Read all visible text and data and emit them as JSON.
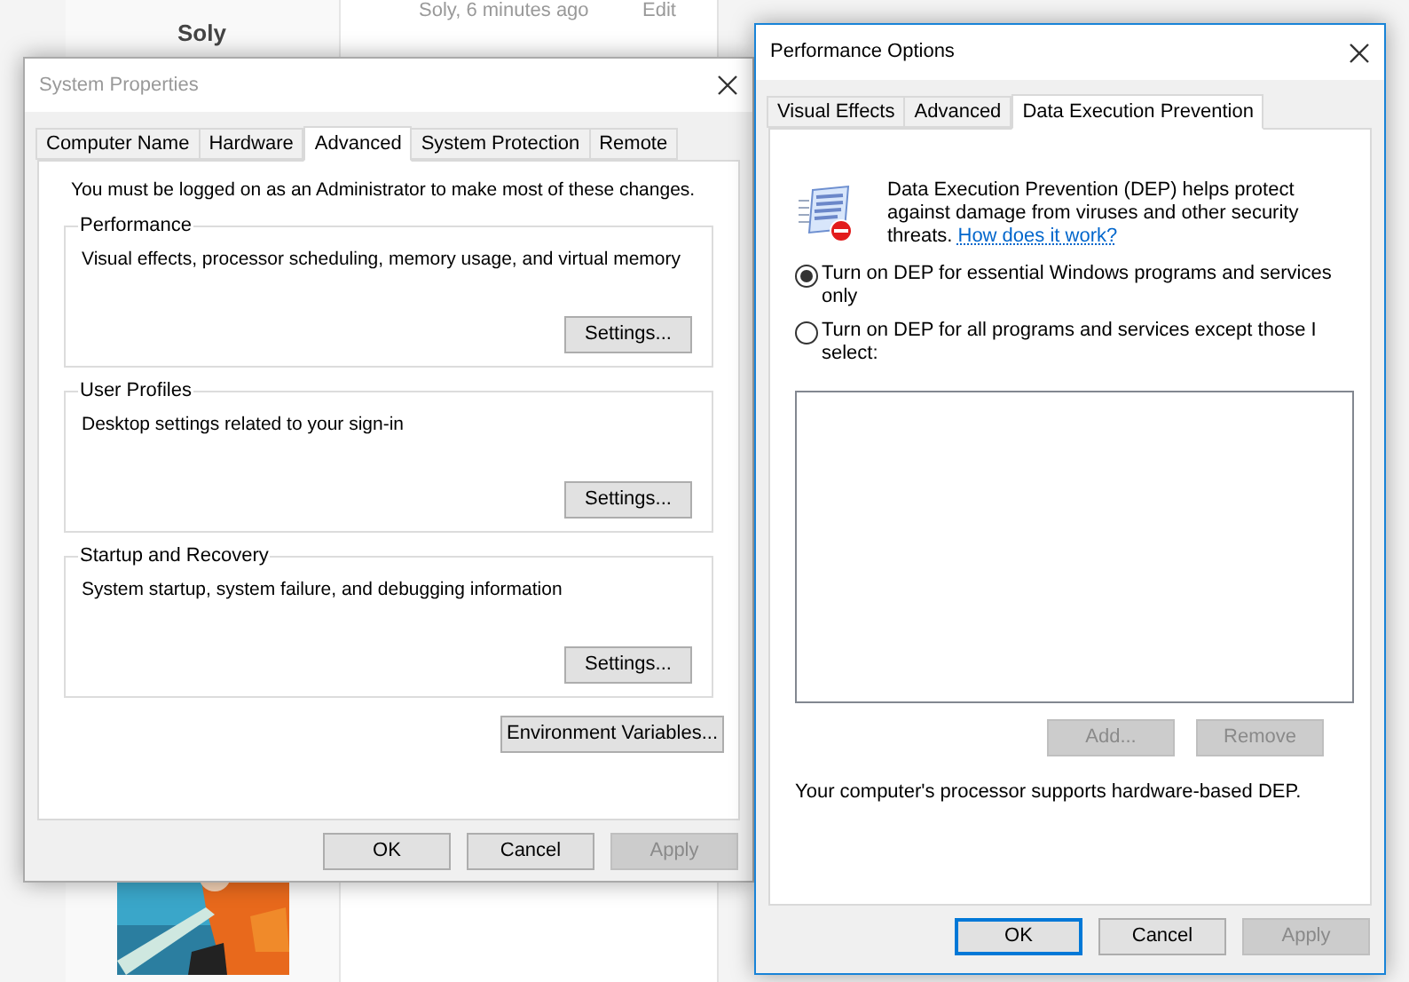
{
  "forum_post": {
    "author": "Soly",
    "meta": "Soly, 6 minutes ago",
    "edit_link": "Edit"
  },
  "system_properties": {
    "title": "System Properties",
    "tabs": [
      {
        "label": "Computer Name",
        "selected": false
      },
      {
        "label": "Hardware",
        "selected": false
      },
      {
        "label": "Advanced",
        "selected": true
      },
      {
        "label": "System Protection",
        "selected": false
      },
      {
        "label": "Remote",
        "selected": false
      }
    ],
    "notice": "You must be logged on as an Administrator to make most of these changes.",
    "groups": [
      {
        "title": "Performance",
        "description": "Visual effects, processor scheduling, memory usage, and virtual memory",
        "button": "Settings..."
      },
      {
        "title": "User Profiles",
        "description": "Desktop settings related to your sign-in",
        "button": "Settings..."
      },
      {
        "title": "Startup and Recovery",
        "description": "System startup, system failure, and debugging information",
        "button": "Settings..."
      }
    ],
    "env_button": "Environment Variables...",
    "buttons": [
      {
        "label": "OK",
        "disabled": false
      },
      {
        "label": "Cancel",
        "disabled": false
      },
      {
        "label": "Apply",
        "disabled": true
      }
    ]
  },
  "performance_options": {
    "title": "Performance Options",
    "tabs": [
      {
        "label": "Visual Effects",
        "selected": false
      },
      {
        "label": "Advanced",
        "selected": false
      },
      {
        "label": "Data Execution Prevention",
        "selected": true
      }
    ],
    "description": "Data Execution Prevention (DEP) helps protect against damage from viruses and other security threats.",
    "help_link": "How does it work?",
    "options": [
      {
        "label": "Turn on DEP for essential Windows programs and services only",
        "selected": true
      },
      {
        "label": "Turn on DEP for all programs and services except those I select:",
        "selected": false
      }
    ],
    "list_buttons": [
      {
        "label": "Add...",
        "disabled": true
      },
      {
        "label": "Remove",
        "disabled": true
      }
    ],
    "status": "Your computer's processor supports hardware-based DEP.",
    "buttons": [
      {
        "label": "OK",
        "disabled": false,
        "default": true
      },
      {
        "label": "Cancel",
        "disabled": false,
        "default": false
      },
      {
        "label": "Apply",
        "disabled": true,
        "default": false
      }
    ]
  }
}
